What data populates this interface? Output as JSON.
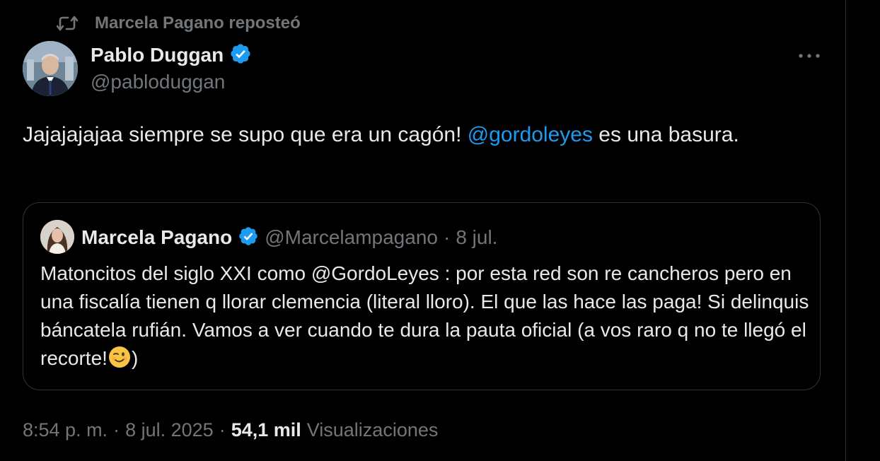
{
  "repost": {
    "text": "Marcela Pagano reposteó"
  },
  "tweet": {
    "author_name": "Pablo Duggan",
    "author_handle": "@pabloduggan",
    "text_before": "Jajajajajaa siempre se supo que era un cagón! ",
    "mention": "@gordoleyes",
    "text_after": " es una basura.",
    "time": "8:54 p. m.",
    "separator": "·",
    "date": "8 jul. 2025",
    "views_count": "54,1 mil",
    "views_label": "Visualizaciones"
  },
  "quote": {
    "author_name": "Marcela Pagano",
    "author_handle": "@Marcelampagano",
    "separator": "·",
    "date": "8 jul.",
    "text": "Matoncitos del siglo XXI como @GordoLeyes : por esta red son re cancheros pero en una fiscalía tienen q llorar clemencia (literal lloro). El que las hace las paga! Si delinquis báncatela rufián. Vamos a ver cuando te dura la pauta oficial (a vos raro q no te llegó el recorte!",
    "text_end": ")"
  },
  "icons": {
    "repost": "repost-icon",
    "verified": "verified-badge-icon",
    "more": "more-icon",
    "emoji": "winking-face-emoji"
  },
  "colors": {
    "background": "#000000",
    "text": "#e7e9ea",
    "muted": "#71767b",
    "link": "#1d9bf0",
    "border": "#2f3336"
  }
}
